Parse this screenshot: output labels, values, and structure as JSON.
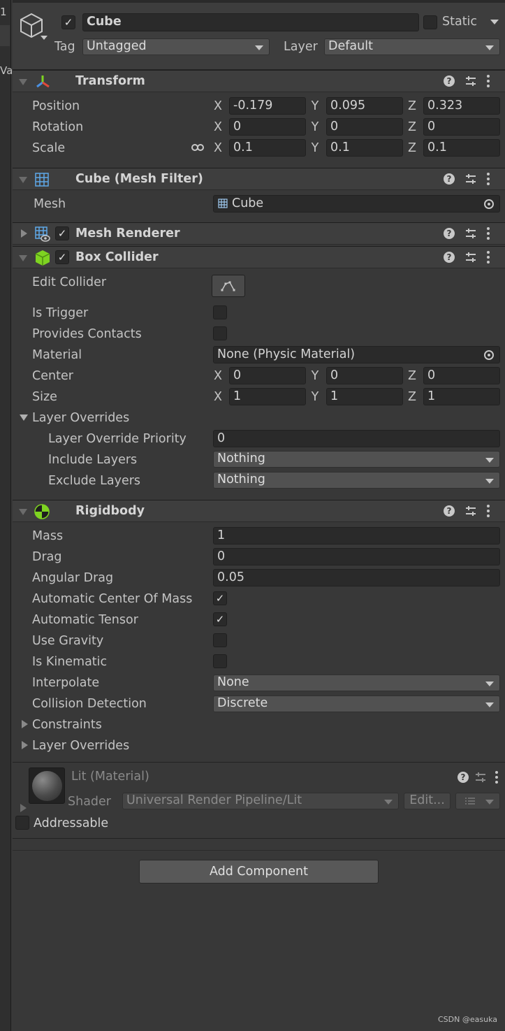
{
  "left_strip": {
    "text1": "1",
    "text2": "Va"
  },
  "header": {
    "active": "✓",
    "name": "Cube",
    "static_label": "Static",
    "tag_label": "Tag",
    "tag_value": "Untagged",
    "layer_label": "Layer",
    "layer_value": "Default"
  },
  "transform": {
    "title": "Transform",
    "position_label": "Position",
    "rotation_label": "Rotation",
    "scale_label": "Scale",
    "x": "X",
    "y": "Y",
    "z": "Z",
    "position": [
      "-0.179",
      "0.095",
      "0.323"
    ],
    "rotation": [
      "0",
      "0",
      "0"
    ],
    "scale": [
      "0.1",
      "0.1",
      "0.1"
    ]
  },
  "mesh_filter": {
    "title": "Cube (Mesh Filter)",
    "mesh_label": "Mesh",
    "mesh_value": "Cube"
  },
  "mesh_renderer": {
    "title": "Mesh Renderer",
    "enabled": "✓"
  },
  "box_collider": {
    "title": "Box Collider",
    "enabled": "✓",
    "edit_collider_label": "Edit Collider",
    "is_trigger_label": "Is Trigger",
    "provides_contacts_label": "Provides Contacts",
    "material_label": "Material",
    "material_value": "None (Physic Material)",
    "center_label": "Center",
    "center": [
      "0",
      "0",
      "0"
    ],
    "size_label": "Size",
    "size": [
      "1",
      "1",
      "1"
    ],
    "layer_overrides_label": "Layer Overrides",
    "layer_override_priority_label": "Layer Override Priority",
    "layer_override_priority_value": "0",
    "include_layers_label": "Include Layers",
    "include_layers_value": "Nothing",
    "exclude_layers_label": "Exclude Layers",
    "exclude_layers_value": "Nothing"
  },
  "rigidbody": {
    "title": "Rigidbody",
    "mass_label": "Mass",
    "mass_value": "1",
    "drag_label": "Drag",
    "drag_value": "0",
    "angular_drag_label": "Angular Drag",
    "angular_drag_value": "0.05",
    "auto_com_label": "Automatic Center Of Mass",
    "auto_com_check": "✓",
    "auto_tensor_label": "Automatic Tensor",
    "auto_tensor_check": "✓",
    "use_gravity_label": "Use Gravity",
    "is_kinematic_label": "Is Kinematic",
    "interpolate_label": "Interpolate",
    "interpolate_value": "None",
    "collision_label": "Collision Detection",
    "collision_value": "Discrete",
    "constraints_label": "Constraints",
    "layer_overrides_label": "Layer Overrides"
  },
  "material": {
    "title": "Lit (Material)",
    "shader_label": "Shader",
    "shader_value": "Universal Render Pipeline/Lit",
    "edit_label": "Edit...",
    "addressable_label": "Addressable"
  },
  "add_component": "Add Component",
  "watermark": "CSDN @easuka",
  "colors": {
    "background": "#383838",
    "field": "#2a2a2a",
    "header": "#3e3e3e",
    "accent_green": "#7ed321"
  }
}
